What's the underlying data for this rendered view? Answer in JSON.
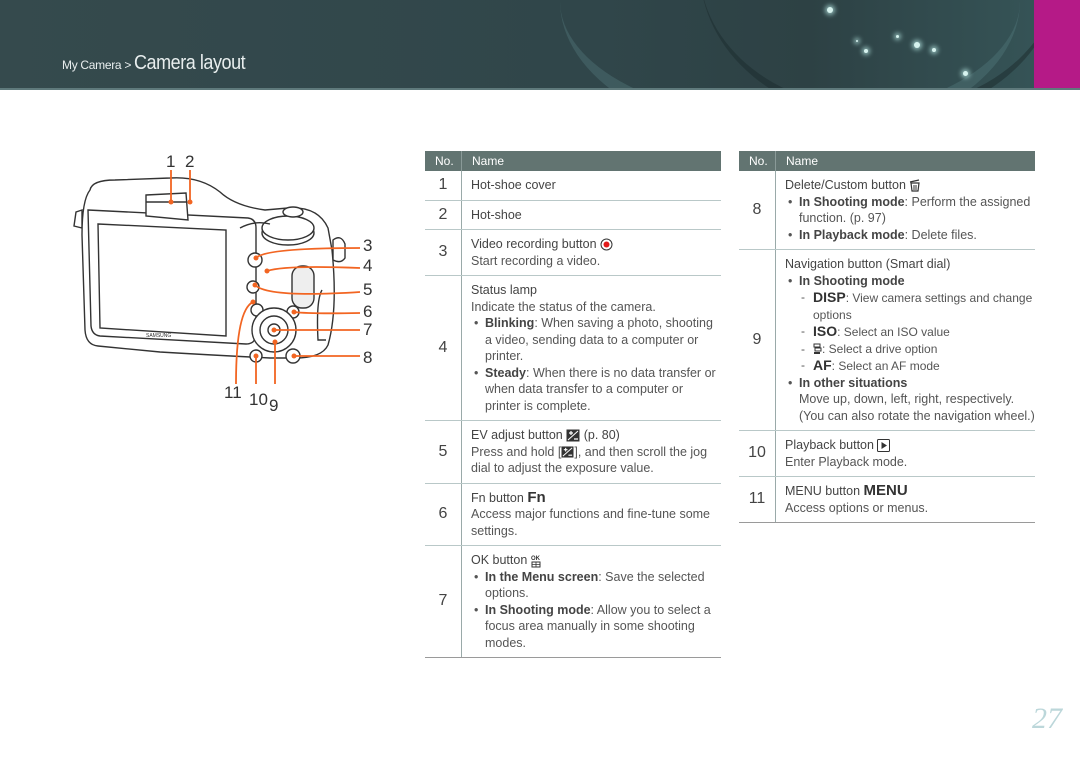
{
  "header": {
    "breadcrumb_parent": "My Camera",
    "separator": ">",
    "title": "Camera layout",
    "accent_color": "#b51a87"
  },
  "diagram": {
    "callouts": [
      "1",
      "2",
      "3",
      "4",
      "5",
      "6",
      "7",
      "8",
      "9",
      "10",
      "11"
    ],
    "brand_label": "SAMSUNG",
    "callout_color": "#f26522"
  },
  "table_left": {
    "col_no": "No.",
    "col_name": "Name",
    "rows": [
      {
        "no": "1",
        "name": "Hot-shoe cover"
      },
      {
        "no": "2",
        "name": "Hot-shoe"
      },
      {
        "no": "3",
        "name": "Video recording button",
        "desc": "Start recording a video."
      },
      {
        "no": "4",
        "name": "Status lamp",
        "desc": "Indicate the status of the camera.",
        "bullets": [
          {
            "term": "Blinking",
            "text": ": When saving a photo, shooting a video, sending data to a computer or printer."
          },
          {
            "term": "Steady",
            "text": ": When there is no data transfer or when data transfer to a computer or printer is complete."
          }
        ]
      },
      {
        "no": "5",
        "name": "EV adjust button",
        "ref": "(p. 80)",
        "desc_pre": "Press and hold [",
        "desc_post": "], and then scroll the jog dial to adjust the exposure value."
      },
      {
        "no": "6",
        "name": "Fn button",
        "icon_text": "Fn",
        "desc": "Access major functions and fine-tune some settings."
      },
      {
        "no": "7",
        "name": "OK button",
        "bullets": [
          {
            "term": "In the Menu screen",
            "text": ": Save the selected options."
          },
          {
            "term": "In Shooting mode",
            "text": ": Allow you to select a focus area manually in some shooting modes."
          }
        ]
      }
    ]
  },
  "table_right": {
    "col_no": "No.",
    "col_name": "Name",
    "rows": [
      {
        "no": "8",
        "name": "Delete/Custom button",
        "bullets": [
          {
            "term": "In Shooting mode",
            "text": ": Perform the assigned function. (p. 97)"
          },
          {
            "term": "In Playback mode",
            "text": ": Delete files."
          }
        ]
      },
      {
        "no": "9",
        "name": "Navigation button (Smart dial)",
        "shooting_label": "In Shooting mode",
        "sub": [
          {
            "key": "DISP",
            "text": ": View camera settings and change options"
          },
          {
            "key": "ISO",
            "text": ": Select an ISO value"
          },
          {
            "key": "drive-icon",
            "text": ": Select a drive option"
          },
          {
            "key": "AF",
            "text": ": Select an AF mode"
          }
        ],
        "other_label": "In other situations",
        "other_text": "Move up, down, left, right, respectively. (You can also rotate the navigation wheel.)"
      },
      {
        "no": "10",
        "name": "Playback button",
        "desc": "Enter Playback mode."
      },
      {
        "no": "11",
        "name": "MENU button",
        "icon_text": "MENU",
        "desc": "Access options or menus."
      }
    ]
  },
  "page_number": "27"
}
